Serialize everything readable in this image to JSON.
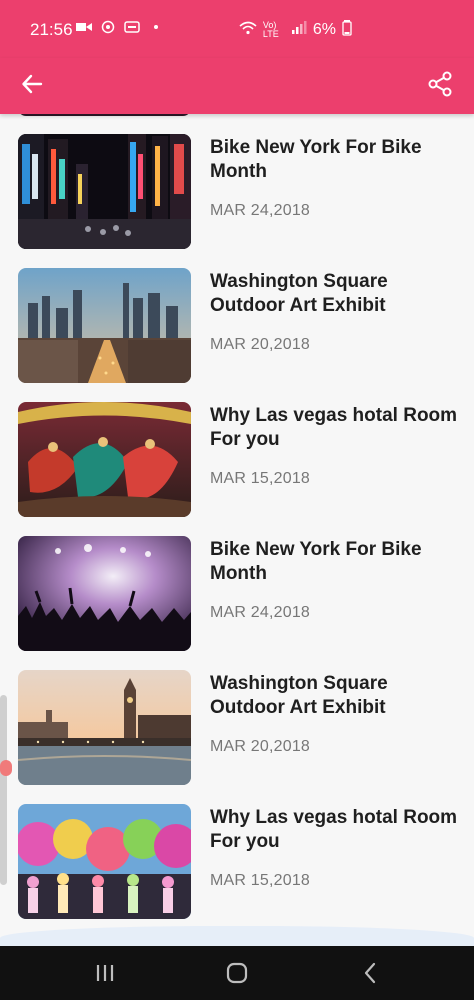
{
  "status_bar": {
    "time": "21:56",
    "network": "Vo) LTE",
    "battery": "6%"
  },
  "app_bar": {
    "back_icon": "arrow-left-icon",
    "share_icon": "share-icon"
  },
  "list": {
    "items": [
      {
        "title": "Bike New York For Bike Month",
        "date": "MAR 24,2018",
        "thumb": "night-city-street"
      },
      {
        "title": "Washington Square Outdoor Art Exhibit",
        "date": "MAR 20,2018",
        "thumb": "city-skyline"
      },
      {
        "title": "Why Las vegas hotal Room For you",
        "date": "MAR 15,2018",
        "thumb": "dancers"
      },
      {
        "title": "Bike New York For Bike Month",
        "date": "MAR 24,2018",
        "thumb": "concert-crowd"
      },
      {
        "title": "Washington Square Outdoor Art Exhibit",
        "date": "MAR 20,2018",
        "thumb": "london-bridge"
      },
      {
        "title": "Why Las vegas hotal Room For you",
        "date": "MAR 15,2018",
        "thumb": "holi-festival"
      }
    ]
  },
  "navigation_bar": {
    "recents_icon": "recents-icon",
    "home_icon": "home-icon",
    "back_icon": "system-back-icon"
  },
  "colors": {
    "accent": "#ec3f6d",
    "title_text": "#1f1f1f",
    "date_text": "#777777"
  }
}
